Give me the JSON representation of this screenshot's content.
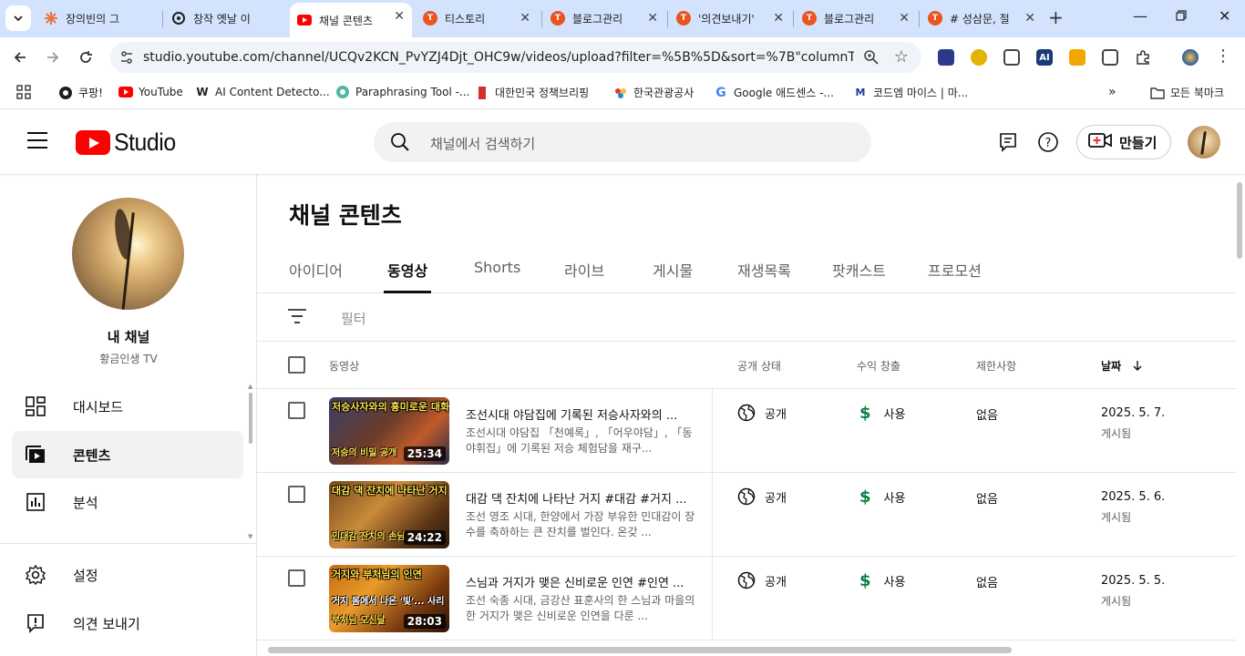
{
  "browser": {
    "tabs": [
      {
        "title": "장의빈의 그",
        "active": false,
        "favicon": "sunburst-icon",
        "color": "#e8753a"
      },
      {
        "title": "창작 옛날 이",
        "active": false,
        "favicon": "openai-icon",
        "color": "#202020"
      },
      {
        "title": "채널 콘텐츠",
        "active": true,
        "favicon": "youtube-icon",
        "color": "#ff0000"
      },
      {
        "title": "티스토리",
        "active": false,
        "favicon": "tistory-icon",
        "color": "#eb531f"
      },
      {
        "title": "블로그관리",
        "active": false,
        "favicon": "tistory-icon",
        "color": "#eb531f"
      },
      {
        "title": "'의견보내기'",
        "active": false,
        "favicon": "tistory-icon",
        "color": "#eb531f"
      },
      {
        "title": "블로그관리",
        "active": false,
        "favicon": "tistory-icon",
        "color": "#eb531f"
      },
      {
        "title": "# 성삼문, 절",
        "active": false,
        "favicon": "tistory-icon",
        "color": "#eb531f"
      }
    ],
    "url": "studio.youtube.com/channel/UCQv2KCN_PvYZJ4Djt_OHC9w/videos/upload?filter=%5B%5D&sort=%7B\"columnType\"%3A...",
    "bookmarks": [
      {
        "label": "쿠팡!",
        "icon": "coupang-icon"
      },
      {
        "label": "YouTube",
        "icon": "youtube-icon"
      },
      {
        "label": "AI Content Detecto...",
        "icon": "writer-icon"
      },
      {
        "label": "Paraphrasing Tool -...",
        "icon": "quillbot-icon"
      },
      {
        "label": "대한민국 정책브리핑",
        "icon": "korea-gov-icon"
      },
      {
        "label": "한국관광공사",
        "icon": "kto-icon"
      },
      {
        "label": "Google 애드센스 -...",
        "icon": "google-icon"
      },
      {
        "label": "코드엠 마이스 | 마...",
        "icon": "codem-icon"
      }
    ],
    "all_bookmarks": "모든 북마크"
  },
  "studio": {
    "logo_text": "Studio",
    "search_placeholder": "채널에서 검색하기",
    "create_label": "만들기"
  },
  "sidebar": {
    "channel_name": "내 채널",
    "channel_handle": "황금인생 TV",
    "items": [
      {
        "label": "대시보드",
        "icon": "dashboard-icon",
        "active": false
      },
      {
        "label": "콘텐츠",
        "icon": "content-icon",
        "active": true
      },
      {
        "label": "분석",
        "icon": "analytics-icon",
        "active": false
      },
      {
        "label": "설정",
        "icon": "settings-icon",
        "active": false
      },
      {
        "label": "의견 보내기",
        "icon": "feedback-icon",
        "active": false
      }
    ]
  },
  "content": {
    "title": "채널 콘텐츠",
    "tabs": [
      "아이디어",
      "동영상",
      "Shorts",
      "라이브",
      "게시물",
      "재생목록",
      "팟캐스트",
      "프로모션"
    ],
    "active_tab": "동영상",
    "filter_placeholder": "필터",
    "columns": {
      "video": "동영상",
      "visibility": "공개 상태",
      "monetization": "수익 창출",
      "restrictions": "제한사항",
      "date": "날짜"
    },
    "rows": [
      {
        "thumb_top": "저승사자와의 흥미로운 대화",
        "thumb_mid": "",
        "thumb_bottom": "저승의 비밀 공개",
        "duration": "25:34",
        "title": "조선시대 야담집에 기록된 저승사자와의 ...",
        "description": "조선시대 야담집 「천예록」, 「어우야담」, 「동야휘집」에 기록된 저승 체험담을 재구...",
        "visibility": "공개",
        "monetization": "사용",
        "restrictions": "없음",
        "date": "2025. 5. 7.",
        "status": "게시됨",
        "thumb_bg": "linear-gradient(135deg,#3a3f6b 0%,#6a3c2a 45%,#c05a2a 70%,#2b2b4a 100%)"
      },
      {
        "thumb_top": "대감 댁 잔치에 나타난 거지",
        "thumb_mid": "",
        "thumb_bottom": "민대감 잔치의 손님",
        "duration": "24:22",
        "title": "대감 댁 잔치에 나타난 거지 #대감 #거지 ...",
        "description": "조선 영조 시대, 한양에서 가장 부유한 민대감이 장수를 축하하는 큰 잔치를 벌인다. 온갖 ...",
        "visibility": "공개",
        "monetization": "사용",
        "restrictions": "없음",
        "date": "2025. 5. 6.",
        "status": "게시됨",
        "thumb_bg": "linear-gradient(135deg,#7a4a1e 0%,#c98a3a 40%,#5a3415 75%,#2a1a0e 100%)"
      },
      {
        "thumb_top": "거지와 부처님의 인연",
        "thumb_mid": "거지 몸에서 나온 '빛'... 사리",
        "thumb_bottom": "부처님 오신날",
        "duration": "28:03",
        "title": "스님과 거지가 맺은 신비로운 인연 #인연 ...",
        "description": "조선 숙종 시대, 금강산 표훈사의 한 스님과 마을의 한 거지가 맺은 신비로운 인연을 다룬 ...",
        "visibility": "공개",
        "monetization": "사용",
        "restrictions": "없음",
        "date": "2025. 5. 5.",
        "status": "게시됨",
        "thumb_bg": "linear-gradient(135deg,#c86a12 0%,#e89a2a 35%,#7a3a10 70%,#2a1408 100%)"
      }
    ]
  },
  "colors": {
    "tabstrip": "#d3e3fd",
    "youtube_red": "#ff0000",
    "monetization_green": "#0b8043"
  }
}
